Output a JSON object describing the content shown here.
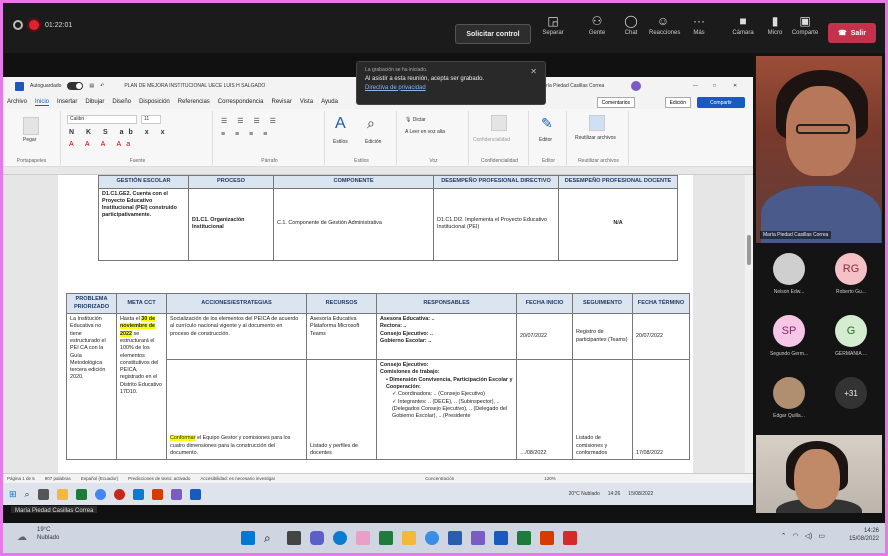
{
  "teams": {
    "timer": "01:22:01",
    "request_control": "Solicitar control",
    "toolbar": [
      {
        "icon": "share-tray-icon",
        "label": "Separar"
      },
      {
        "icon": "people-icon",
        "label": "Gente"
      },
      {
        "icon": "chat-icon",
        "label": "Chat"
      },
      {
        "icon": "reactions-icon",
        "label": "Reacciones"
      },
      {
        "icon": "more-icon",
        "label": "Más"
      },
      {
        "icon": "camera-icon",
        "label": "Cámara"
      },
      {
        "icon": "mic-icon",
        "label": "Micro"
      },
      {
        "icon": "share-icon",
        "label": "Comparte"
      }
    ],
    "leave": "Salir",
    "leave_color": "#c4314b"
  },
  "popup": {
    "small": "La grabación se ha iniciado.",
    "text": "Al asistir a esta reunión, acepta ser grabado.",
    "link": "Directiva de privacidad"
  },
  "word": {
    "autosave": "Autoguardado",
    "doc_title": "PLAN DE MEJORA INSTITUCIONAL UECE LUIS H SALGADO",
    "user": "María Piedad Casillas Correa",
    "tabs": [
      "Archivo",
      "Inicio",
      "Insertar",
      "Dibujar",
      "Diseño",
      "Disposición",
      "Referencias",
      "Correspondencia",
      "Revisar",
      "Vista",
      "Ayuda"
    ],
    "active_tab": "Inicio",
    "comments": "Comentarios",
    "editing": "Edición",
    "share": "Compartir",
    "ribbon_groups": [
      "Portapapeles",
      "Fuente",
      "Párrafo",
      "Estilos",
      "Voz",
      "Confidencialidad",
      "Editor",
      "Reutilizar archivos"
    ],
    "ribbon_buttons": [
      "Pegar",
      "Estilos",
      "Edición",
      "Dictar",
      "Leer en voz alta",
      "Confidencialidad",
      "Editor",
      "Reutilizar archivos"
    ],
    "font_name": "Calibri",
    "font_size": "11",
    "status": [
      "Página 1 de 6",
      "907 palabras",
      "Español (Ecuador)",
      "Predicciones de texto: activado",
      "Accesibilidad: es necesario investigar",
      "Concentración",
      "120%"
    ]
  },
  "table1": {
    "headers": [
      "GESTIÓN ESCOLAR",
      "PROCESO",
      "COMPONENTE",
      "DESEMPEÑO PROFESIONAL DIRECTIVO",
      "DESEMPEÑO PROFESIONAL DOCENTE"
    ],
    "row": [
      "D1.C1.GE2. Cuenta con el Proyecto Educativo Institucional (PEI) construido participativamente.",
      "D1.C1. Organización Institucional",
      "C.1. Componente de Gestión Administrativa",
      "D1.C1.DI2. Implementa el Proyecto Educativo Institucional (PEI)",
      "N/A"
    ]
  },
  "table2": {
    "headers": [
      "PROBLEMA PRIORIZADO",
      "META CCT",
      "ACCIONES/ESTRATEGIAS",
      "RECURSOS",
      "RESPONSABLES",
      "FECHA INICIO",
      "SEGUIMIENTO",
      "FECHA TÉRMINO"
    ],
    "problem": "La Institución Educativa no tiene estructurado el PEI CA con la Guía Metodológica tercera edición 2020.",
    "goal_pre": "Hasta el ",
    "goal_date": "30 de noviembre de 2022",
    "goal_post": " se estructurará el 100% de los elementos constitutivos del PEICA, registrado en el Distrito Educativo 17D10.",
    "row1": {
      "action": "Socialización de los elementos del PEICA de acuerdo al currículo nacional vigente y al documento en proceso de construcción.",
      "resources": "Asesoría Educativa Plataforma Microsoft Teams",
      "responsibles": [
        "Asesora Educativa: ..",
        "Rectora: ..",
        "Consejo Ejecutivo: ..",
        "Gobierno Escolar: .."
      ],
      "start": "20/07/2022",
      "followup": "Registro de participantes (Teams)",
      "end": "20/07/2022"
    },
    "row2": {
      "action_hl": "Conformar",
      "action_rest": " el Equipo Gestor y comisiones para los cuatro dimensiones para la construcción del documento.",
      "resources": "Listado y perfiles de docentes",
      "responsibles": [
        "Consejo Ejecutivo:",
        "Comisiones de trabajo:",
        "• Dimensión Convivencia, Participación Escolar y Cooperación:",
        "✓ Coordinadora: .. (Consejo Ejecutivo)",
        "✓ Integrantes: .. (DECE), .. (Subinspector), .. (Delegados Consejo Ejecutivo), .. (Delegado del Gobierno Escolar), .. (Presidente"
      ],
      "start": "…/08/2022",
      "followup": "Listado de comisiones y conformados",
      "end": "17/08/2022"
    }
  },
  "word_taskbar": {
    "weather": "20°C Nublado",
    "time": "14:26",
    "date": "15/08/2022"
  },
  "presenter_label": "María Piedad Casillas Correa",
  "participants": {
    "main_name": "María Piedad Casillas Correa",
    "list": [
      {
        "initials": "",
        "name": "Nelson Edw...",
        "color": "#cfcfcf"
      },
      {
        "initials": "RG",
        "name": "Roberto Gu...",
        "color": "#f6c1c6"
      },
      {
        "initials": "SP",
        "name": "Segundo Germ...",
        "color": "#f6c6e6"
      },
      {
        "initials": "G",
        "name": "GERMANIA ...",
        "color": "#d4ecd0"
      },
      {
        "initials": "",
        "name": "Edgar Quilla...",
        "color": "#b08e70"
      },
      {
        "initials": "+31",
        "name": "",
        "color": "#333333"
      }
    ]
  },
  "taskbar": {
    "weather_temp": "19°C",
    "weather_desc": "Nublado",
    "time": "14:26",
    "date": "15/08/2022"
  }
}
